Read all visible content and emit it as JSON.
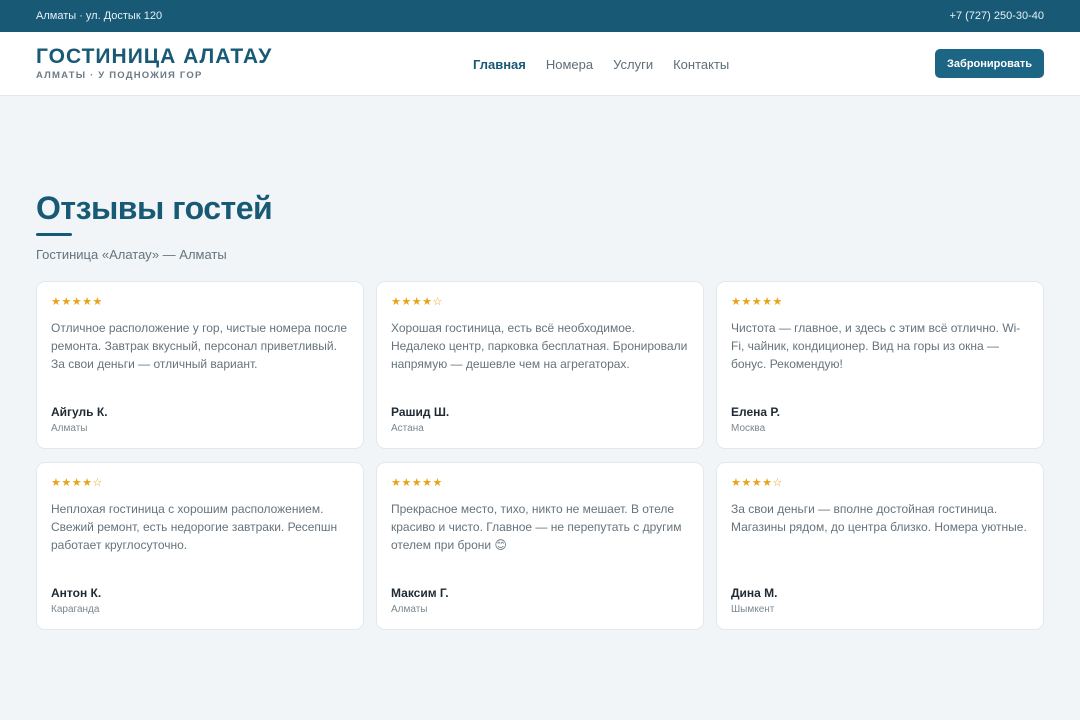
{
  "topbar": {
    "address": "Алматы · ул. Достык 120",
    "phone": "+7 (727) 250-30-40"
  },
  "header": {
    "brand_name": "ГОСТИНИЦА АЛАТАУ",
    "brand_tagline": "АЛМАТЫ · У ПОДНОЖИЯ ГОР",
    "nav": [
      {
        "label": "Главная",
        "active": true
      },
      {
        "label": "Номера",
        "active": false
      },
      {
        "label": "Услуги",
        "active": false
      },
      {
        "label": "Контакты",
        "active": false
      }
    ],
    "book_label": "Забронировать"
  },
  "reviews_section": {
    "title": "Отзывы гостей",
    "subtitle": "Гостиница «Алатау» — Алматы",
    "reviews": [
      {
        "rating": 5,
        "stars": "★★★★★",
        "text": "Отличное расположение у гор, чистые номера после ремонта. Завтрак вкусный, персонал приветливый. За свои деньги — отличный вариант.",
        "author": "Айгуль К.",
        "city": "Алматы"
      },
      {
        "rating": 4,
        "stars": "★★★★☆",
        "text": "Хорошая гостиница, есть всё необходимое. Недалеко центр, парковка бесплатная. Бронировали напрямую — дешевле чем на агрегаторах.",
        "author": "Рашид Ш.",
        "city": "Астана"
      },
      {
        "rating": 5,
        "stars": "★★★★★",
        "text": "Чистота — главное, и здесь с этим всё отлично. Wi-Fi, чайник, кондиционер. Вид на горы из окна — бонус. Рекомендую!",
        "author": "Елена Р.",
        "city": "Москва"
      },
      {
        "rating": 4,
        "stars": "★★★★☆",
        "text": "Неплохая гостиница с хорошим расположением. Свежий ремонт, есть недорогие завтраки. Ресепшн работает круглосуточно.",
        "author": "Антон К.",
        "city": "Караганда"
      },
      {
        "rating": 5,
        "stars": "★★★★★",
        "text": "Прекрасное место, тихо, никто не мешает. В отеле красиво и чисто. Главное — не перепутать с другим отелем при брони 😊",
        "author": "Максим Г.",
        "city": "Алматы"
      },
      {
        "rating": 4,
        "stars": "★★★★☆",
        "text": "За свои деньги — вполне достойная гостиница. Магазины рядом, до центра близко. Номера уютные.",
        "author": "Дина М.",
        "city": "Шымкент"
      }
    ]
  },
  "colors": {
    "primary": "#185a76",
    "button": "#1d6585",
    "star": "#e8a317",
    "background": "#f1f5f8"
  }
}
